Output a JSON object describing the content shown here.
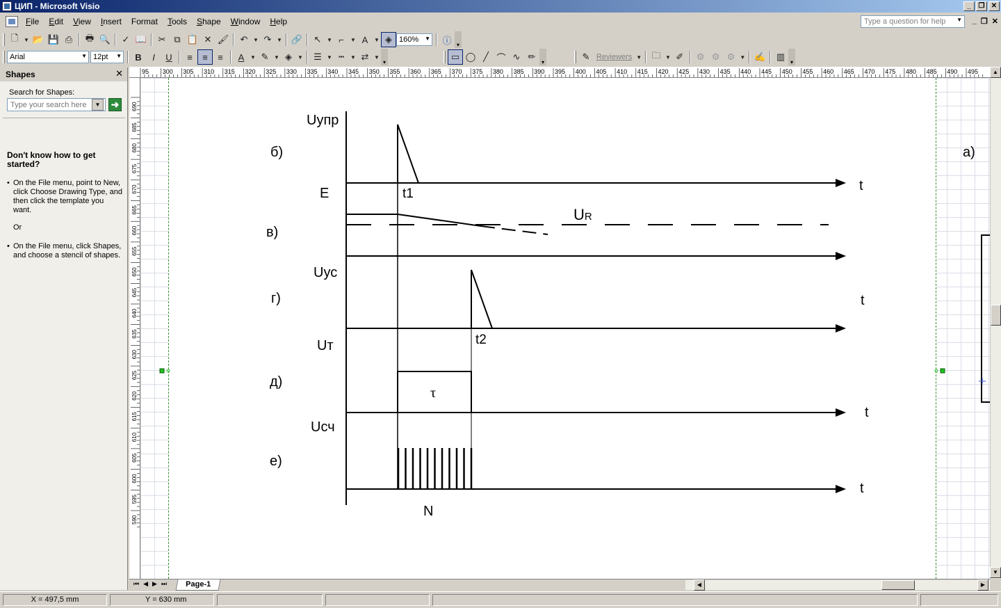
{
  "window": {
    "title": "ЦИП - Microsoft Visio"
  },
  "menu": {
    "items": [
      {
        "u": "F",
        "rest": "ile"
      },
      {
        "u": "E",
        "rest": "dit"
      },
      {
        "u": "V",
        "rest": "iew"
      },
      {
        "u": "I",
        "rest": "nsert"
      },
      {
        "u": "F",
        "rest": "ormat",
        "pre": ""
      },
      {
        "u": "T",
        "rest": "ools"
      },
      {
        "u": "S",
        "rest": "hape"
      },
      {
        "u": "W",
        "rest": "indow"
      },
      {
        "u": "H",
        "rest": "elp"
      }
    ],
    "help_placeholder": "Type a question for help"
  },
  "toolbar": {
    "zoom": "160%",
    "font": "Arial",
    "size": "12pt",
    "reviewers": "Reviewers"
  },
  "shapes_pane": {
    "title": "Shapes",
    "search_label": "Search for Shapes:",
    "search_placeholder": "Type your search here",
    "help_title": "Don't know how to get started?",
    "tip1": "On the File menu, point to New, click Choose Drawing Type, and then click the template you want.",
    "or": "Or",
    "tip2": "On the File menu, click Shapes, and choose a stencil of shapes."
  },
  "ruler": {
    "h_labels": [
      "95",
      "300",
      "305",
      "310",
      "315",
      "320",
      "325",
      "330",
      "335",
      "340",
      "345",
      "350",
      "355",
      "360",
      "365",
      "370",
      "375",
      "380",
      "385",
      "390",
      "395",
      "400",
      "405",
      "410",
      "415",
      "420",
      "425",
      "430",
      "435",
      "440",
      "445",
      "450",
      "455",
      "460",
      "465",
      "470",
      "475",
      "480",
      "485",
      "490",
      "495"
    ],
    "v_labels": [
      "690",
      "685",
      "680",
      "675",
      "670",
      "665",
      "660",
      "655",
      "650",
      "645",
      "640",
      "635",
      "630",
      "625",
      "620",
      "615",
      "610",
      "605",
      "600",
      "595",
      "590"
    ]
  },
  "diagram": {
    "row_labels": [
      "б)",
      "в)",
      "г)",
      "д)",
      "е)",
      "а)"
    ],
    "signal_labels": [
      "Uупр",
      "E",
      "Uус",
      "Uт",
      "Uсч"
    ],
    "t_label": "t",
    "t1": "t1",
    "t2": "t2",
    "ur_main": "U",
    "ur_sub": "R",
    "tau": "τ",
    "n": "N"
  },
  "tabs": {
    "page": "Page-1"
  },
  "status": {
    "x": "X = 497,5 mm",
    "y": "Y = 630 mm"
  }
}
